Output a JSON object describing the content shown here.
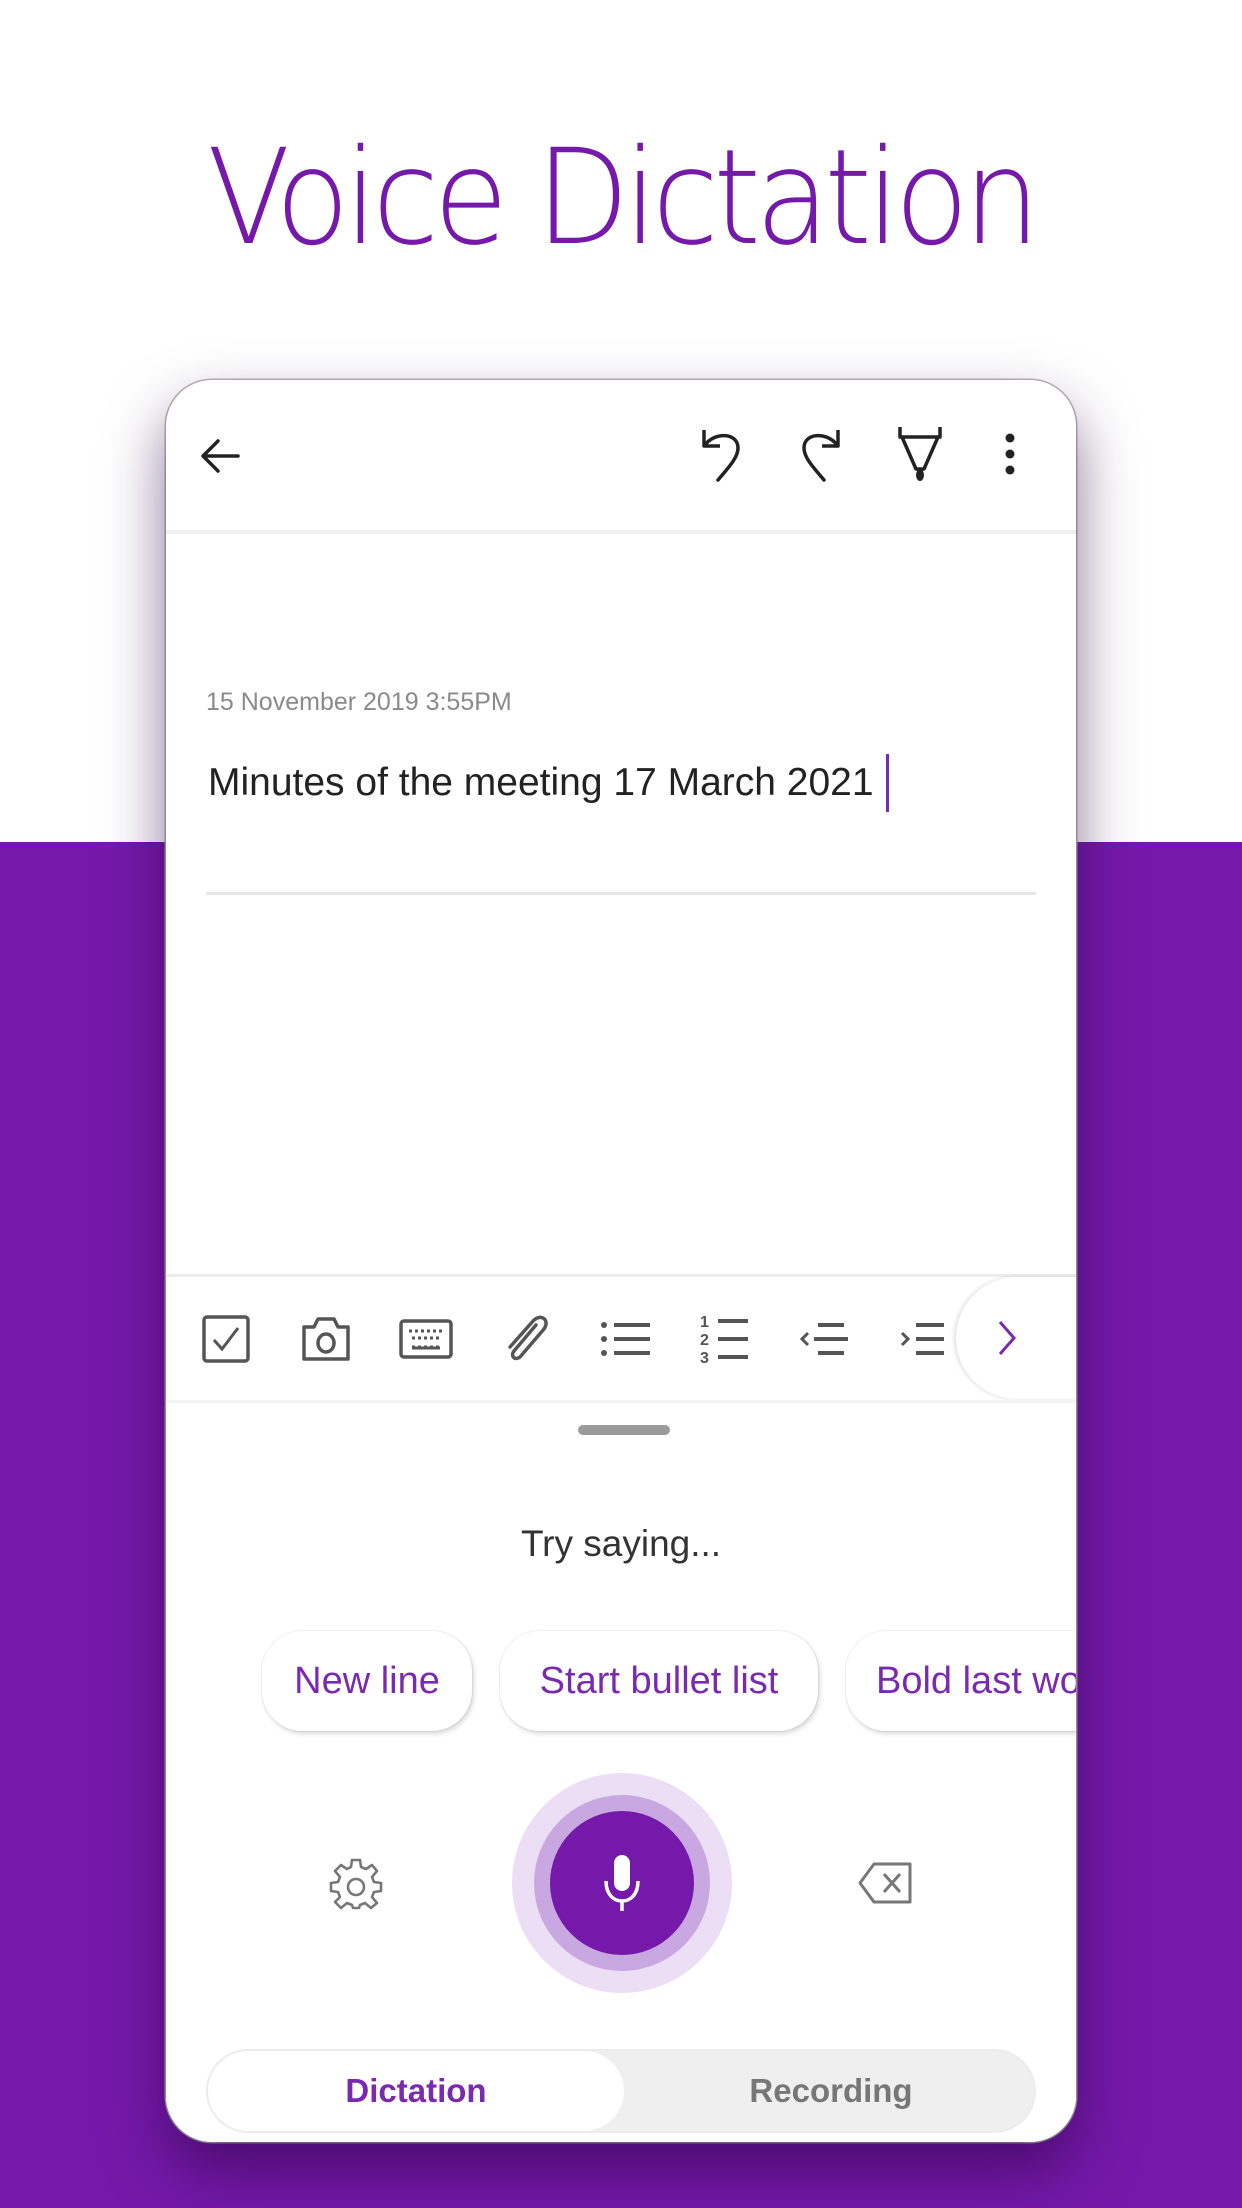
{
  "hero": {
    "title": "Voice Dictation"
  },
  "colors": {
    "brand_purple": "#7519aa",
    "accent_text": "#7a2ab0",
    "icon_gray": "#555555"
  },
  "topbar": {
    "back_icon": "arrow-left-icon",
    "actions": [
      {
        "name": "undo",
        "icon": "undo-icon"
      },
      {
        "name": "redo",
        "icon": "redo-icon"
      },
      {
        "name": "draw",
        "icon": "pen-icon"
      },
      {
        "name": "more",
        "icon": "more-vertical-icon"
      }
    ]
  },
  "note": {
    "date": "15 November 2019 3:55PM",
    "body": "Minutes of the meeting 17 March 2021"
  },
  "format_toolbar": {
    "tools": [
      {
        "name": "checkbox",
        "icon": "checkbox-icon"
      },
      {
        "name": "camera",
        "icon": "camera-icon"
      },
      {
        "name": "keyboard",
        "icon": "keyboard-icon"
      },
      {
        "name": "attach",
        "icon": "paperclip-icon"
      },
      {
        "name": "bullet-list",
        "icon": "bullet-list-icon"
      },
      {
        "name": "numbered-list",
        "icon": "numbered-list-icon"
      },
      {
        "name": "outdent",
        "icon": "outdent-icon"
      },
      {
        "name": "indent",
        "icon": "indent-icon"
      }
    ],
    "more_icon": "chevron-right-icon"
  },
  "dictation": {
    "prompt": "Try saying...",
    "suggestions": [
      "New line",
      "Start bullet list",
      "Bold last wo"
    ],
    "settings_icon": "gear-icon",
    "mic_icon": "microphone-icon",
    "delete_icon": "backspace-icon",
    "modes": {
      "active": "Dictation",
      "inactive": "Recording"
    }
  }
}
